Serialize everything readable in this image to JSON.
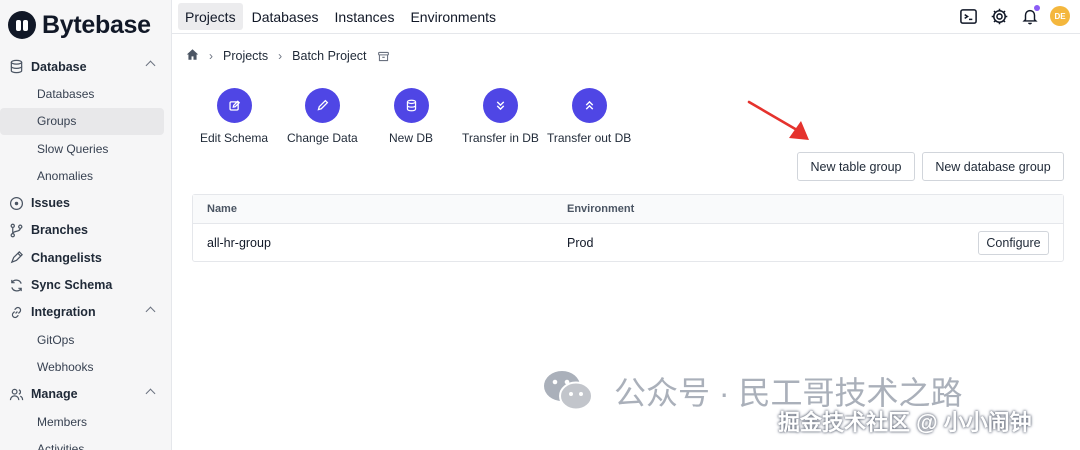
{
  "app": {
    "logo_text": "Bytebase"
  },
  "topnav": {
    "tabs": [
      {
        "label": "Projects",
        "active": true
      },
      {
        "label": "Databases",
        "active": false
      },
      {
        "label": "Instances",
        "active": false
      },
      {
        "label": "Environments",
        "active": false
      }
    ],
    "avatar_initials": "DE"
  },
  "sidebar": {
    "items": [
      {
        "label": "Database",
        "type": "section",
        "icon": "database-icon",
        "expandable": true
      },
      {
        "label": "Databases",
        "type": "sub"
      },
      {
        "label": "Groups",
        "type": "sub",
        "active": true
      },
      {
        "label": "Slow Queries",
        "type": "sub"
      },
      {
        "label": "Anomalies",
        "type": "sub"
      },
      {
        "label": "Issues",
        "type": "section",
        "icon": "issues-icon"
      },
      {
        "label": "Branches",
        "type": "section",
        "icon": "branch-icon"
      },
      {
        "label": "Changelists",
        "type": "section",
        "icon": "changelist-icon"
      },
      {
        "label": "Sync Schema",
        "type": "section",
        "icon": "sync-icon"
      },
      {
        "label": "Integration",
        "type": "section",
        "icon": "link-icon",
        "expandable": true
      },
      {
        "label": "GitOps",
        "type": "sub"
      },
      {
        "label": "Webhooks",
        "type": "sub"
      },
      {
        "label": "Manage",
        "type": "section",
        "icon": "users-icon",
        "expandable": true
      },
      {
        "label": "Members",
        "type": "sub"
      },
      {
        "label": "Activities",
        "type": "sub"
      }
    ]
  },
  "breadcrumb": {
    "items": [
      "Projects",
      "Batch Project"
    ]
  },
  "actions": [
    {
      "label": "Edit Schema",
      "icon": "edit-icon"
    },
    {
      "label": "Change Data",
      "icon": "pencil-icon"
    },
    {
      "label": "New DB",
      "icon": "database-icon"
    },
    {
      "label": "Transfer in DB",
      "icon": "chevrons-down-icon"
    },
    {
      "label": "Transfer out DB",
      "icon": "chevrons-up-icon"
    }
  ],
  "buttons": {
    "new_table_group": "New table group",
    "new_database_group": "New database group"
  },
  "table": {
    "columns": [
      "Name",
      "Environment"
    ],
    "rows": [
      {
        "name": "all-hr-group",
        "environment": "Prod",
        "action": "Configure"
      }
    ]
  },
  "colors": {
    "accent": "#4f46e5",
    "arrow": "#e5322d",
    "avatar": "#f4b73d"
  },
  "watermark": {
    "line1": "公众号 · 民工哥技术之路",
    "line2": "掘金技术社区 @ 小小闹钟"
  }
}
